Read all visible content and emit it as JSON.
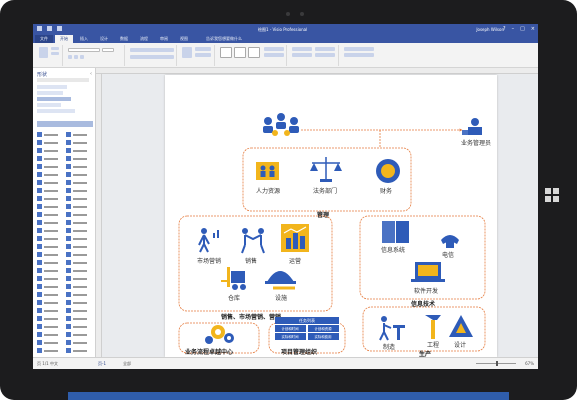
{
  "app": {
    "title": "绘图1 - Visio Professional",
    "user": "Joseph Wilson",
    "window_controls": [
      "?",
      "–",
      "□",
      "×"
    ]
  },
  "ribbon": {
    "tabs": [
      "文件",
      "开始",
      "插入",
      "设计",
      "数据",
      "流程",
      "审阅",
      "视图"
    ],
    "search_placeholder": "告诉我您想要做什么"
  },
  "sidebar": {
    "title": "形状",
    "categories": [
      "更多形状",
      "快速形状",
      "部门",
      "IT和Web",
      "基本流程图"
    ]
  },
  "diagram": {
    "top_label": "管理",
    "top_right_label": "业务管理员",
    "management_items": [
      "人力资源",
      "法务部门",
      "财务"
    ],
    "sales_section": "销售、市场营销、营销",
    "sales_items": [
      "市场营销",
      "销售",
      "运营",
      "仓库",
      "设施"
    ],
    "it_section": "信息技术",
    "it_items": [
      "信息系统",
      "电信",
      "软件开发"
    ],
    "service_section": "业务流程卓越中心",
    "project_section": "项目管理组织",
    "project_items": [
      "任务列表",
      "计划和时间",
      "计划和资源",
      "实际和时间",
      "实际和费用"
    ],
    "production_section": "生产",
    "production_items": [
      "制造",
      "工程",
      "设计"
    ]
  },
  "statusbar": {
    "left_text": "页 1/1  中文",
    "sheet_tab": "页-1",
    "page_tab": "全部",
    "zoom": "67%"
  },
  "colors": {
    "accent": "#3955a3",
    "diagram_blue": "#2e5bb8",
    "diagram_gold": "#f2b51c",
    "diagram_orange": "#e57a3c"
  }
}
